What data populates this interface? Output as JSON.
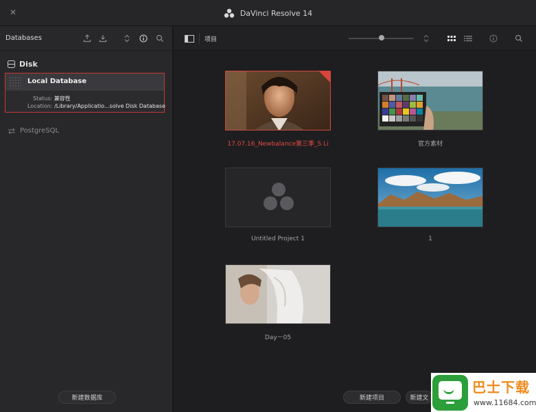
{
  "app": {
    "title": "DaVinci Resolve 14"
  },
  "colors": {
    "accent": "#d9443a",
    "selected_text": "#e24a3f",
    "background": "#1e1e20",
    "panel": "#28282b"
  },
  "left_panel": {
    "header": "Databases",
    "toolbar_icons": [
      "upload-icon",
      "download-icon",
      "sort-icon",
      "info-icon",
      "search-icon"
    ],
    "disk_section": {
      "label": "Disk"
    },
    "databases": [
      {
        "name": "Local Database",
        "status_label": "Status:",
        "status_value": "兼容性",
        "location_label": "Location:",
        "location_value": "/Library/Applicatio...solve Disk Database",
        "selected": true
      }
    ],
    "postgresql": {
      "label": "PostgreSQL"
    },
    "new_db_button": "新建数据库"
  },
  "right_panel": {
    "breadcrumb": "项目",
    "toolbar_icons": [
      "sidebar-toggle-icon",
      "zoom-slider",
      "sort-icon",
      "grid-view-icon",
      "list-view-icon",
      "info-icon",
      "search-icon"
    ],
    "zoom_level": 0.5,
    "projects": [
      {
        "title": "17.07.16_Newbalance第三季_S Li",
        "selected": true,
        "thumb": "portrait-man"
      },
      {
        "title": "官方素材",
        "selected": false,
        "thumb": "color-checker-bay"
      },
      {
        "title": "Untitled Project 1",
        "selected": false,
        "thumb": "resolve-logo"
      },
      {
        "title": "1",
        "selected": false,
        "thumb": "mountain-lake"
      },
      {
        "title": "Day－05",
        "selected": false,
        "thumb": "woman-veil"
      }
    ],
    "new_project_button": "新建项目",
    "new_folder_button": "新建文"
  },
  "watermark": {
    "title": "巴士下载",
    "url": "www.11684.com"
  }
}
